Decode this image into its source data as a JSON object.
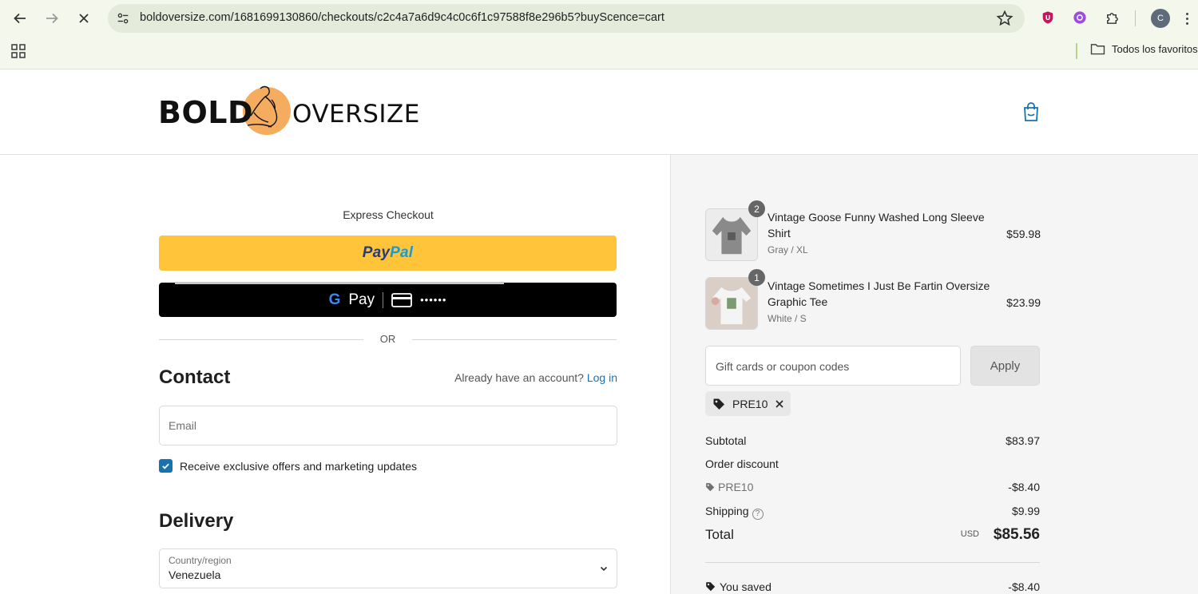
{
  "browser": {
    "url": "boldoversize.com/1681699130860/checkouts/c2c4a7a6d9c4c0c6f1c97588f8e296b5?buyScence=cart",
    "profile_initial": "C",
    "bookmarks_folder": "Todos los favoritos"
  },
  "header": {
    "logo_text_bold": "BOLD",
    "logo_text_over": "OVERSIZE"
  },
  "express": {
    "title": "Express Checkout",
    "paypal_part1": "Pay",
    "paypal_part2": "Pal",
    "gpay_label": "Pay",
    "gpay_card_dots": "••••••",
    "or_label": "OR"
  },
  "contact": {
    "heading": "Contact",
    "account_prompt": "Already have an account?",
    "login_link": "Log in",
    "email_placeholder": "Email",
    "marketing_label": "Receive exclusive offers and marketing updates"
  },
  "delivery": {
    "heading": "Delivery",
    "country_label": "Country/region",
    "country_value": "Venezuela"
  },
  "order": {
    "items": [
      {
        "qty": "2",
        "name": "Vintage Goose Funny Washed Long Sleeve Shirt",
        "variant": "Gray / XL",
        "price": "$59.98"
      },
      {
        "qty": "1",
        "name": "Vintage Sometimes I Just Be Fartin Oversize Graphic Tee",
        "variant": "White / S",
        "price": "$23.99"
      }
    ],
    "coupon_placeholder": "Gift cards or coupon codes",
    "apply_label": "Apply",
    "applied_code": "PRE10",
    "subtotal_label": "Subtotal",
    "subtotal_value": "$83.97",
    "discount_label": "Order discount",
    "discount_code": "PRE10",
    "discount_value": "-$8.40",
    "shipping_label": "Shipping",
    "shipping_value": "$9.99",
    "total_label": "Total",
    "total_currency": "USD",
    "total_value": "$85.56",
    "saved_label": "You saved",
    "saved_value": "-$8.40"
  },
  "colors": {
    "accent_blue": "#1773b0",
    "paypal_yellow": "#ffc439",
    "logo_orange": "#f6ac5e"
  }
}
